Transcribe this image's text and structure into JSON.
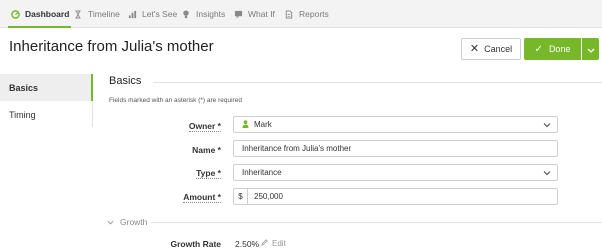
{
  "tabs": [
    {
      "label": "Dashboard",
      "icon": "dashboard-icon",
      "active": true
    },
    {
      "label": "Timeline",
      "icon": "hourglass-icon",
      "active": false
    },
    {
      "label": "Let's See",
      "icon": "bar-chart-icon",
      "active": false
    },
    {
      "label": "Insights",
      "icon": "lightbulb-icon",
      "active": false
    },
    {
      "label": "What If",
      "icon": "chat-icon",
      "active": false
    },
    {
      "label": "Reports",
      "icon": "document-icon",
      "active": false
    }
  ],
  "page": {
    "title": "Inheritance from Julia's mother"
  },
  "actions": {
    "cancel_label": "Cancel",
    "done_label": "Done"
  },
  "sidebar": {
    "items": [
      {
        "label": "Basics",
        "active": true
      },
      {
        "label": "Timing",
        "active": false
      }
    ]
  },
  "section": {
    "title": "Basics",
    "required_note": "Fields marked with an asterisk (*) are required"
  },
  "fields": {
    "owner": {
      "label": "Owner *",
      "value": "Mark"
    },
    "name": {
      "label": "Name *",
      "value": "Inheritance from Julia's mother"
    },
    "type": {
      "label": "Type *",
      "value": "Inheritance"
    },
    "amount": {
      "label": "Amount *",
      "prefix": "$",
      "value": "250,000"
    }
  },
  "growth": {
    "section_label": "Growth",
    "rate_label": "Growth Rate",
    "rate_value": "2.50%",
    "edit_label": "Edit"
  },
  "colors": {
    "accent": "#76b82a"
  }
}
